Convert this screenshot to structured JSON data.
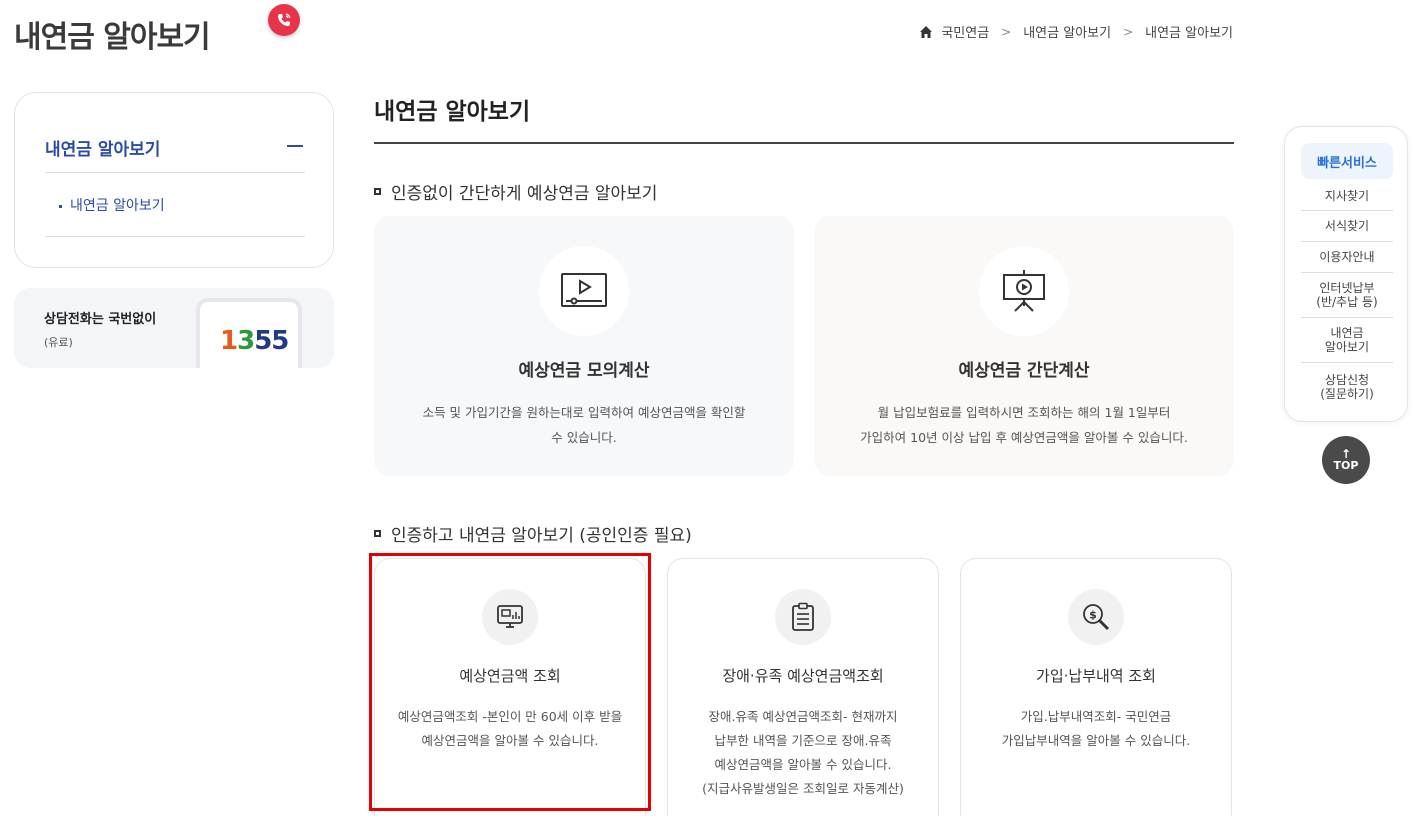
{
  "page_title": "내연금 알아보기",
  "breadcrumb": {
    "items": [
      "국민연금",
      "내연금 알아보기",
      "내연금 알아보기"
    ]
  },
  "sidebar": {
    "menu_title": "내연금 알아보기",
    "sub_item": "내연금 알아보기",
    "call": {
      "title": "상담전화는 국번없이",
      "note": "(유료)",
      "digits": [
        "1",
        "3",
        "55"
      ]
    }
  },
  "main": {
    "title": "내연금 알아보기",
    "section1": {
      "label": "인증없이 간단하게 예상연금 알아보기",
      "cards": [
        {
          "title": "예상연금 모의계산",
          "desc1": "소득 및 가입기간을 원하는대로 입력하여 예상연금액을 확인할",
          "desc2": "수 있습니다.",
          "icon": "video-screen-icon"
        },
        {
          "title": "예상연금 간단계산",
          "desc1": "월 납입보험료를 입력하시면 조회하는 해의 1월 1일부터",
          "desc2": "가입하여 10년 이상 납입 후 예상연금액을 알아볼 수 있습니다.",
          "icon": "presentation-board-icon"
        }
      ]
    },
    "section2": {
      "label": "인증하고 내연금 알아보기 (공인인증 필요)",
      "cards": [
        {
          "title": "예상연금액 조회",
          "lines": [
            "예상연금액조회 -본인이 만 60세 이후 받을",
            "예상연금액을 알아볼 수 있습니다."
          ],
          "icon": "monitor-chart-icon"
        },
        {
          "title": "장애·유족 예상연금액조회",
          "lines": [
            "장애.유족 예상연금액조회- 현재까지",
            "납부한 내역을 기준으로 장애.유족",
            "예상연금액을 알아볼 수 있습니다.",
            "(지급사유발생일은 조회일로 자동계산)"
          ],
          "icon": "clipboard-icon"
        },
        {
          "title": "가입·납부내역 조회",
          "lines": [
            "가입.납부내역조회- 국민연금",
            "가입납부내역을 알아볼 수 있습니다."
          ],
          "icon": "coin-search-icon"
        }
      ]
    }
  },
  "quick_service": {
    "title": "빠른서비스",
    "items": [
      {
        "l1": "지사찾기",
        "l2": ""
      },
      {
        "l1": "서식찾기",
        "l2": ""
      },
      {
        "l1": "이용자안내",
        "l2": ""
      },
      {
        "l1": "인터넷납부",
        "l2": "(반/추납 등)"
      },
      {
        "l1": "내연금",
        "l2": "알아보기"
      },
      {
        "l1": "상담신청",
        "l2": "(질문하기)"
      }
    ],
    "top_label": "TOP"
  },
  "colors": {
    "accent": "#2b4ba8",
    "highlight": "#e50000",
    "quick_title": "#2a6fd6"
  }
}
